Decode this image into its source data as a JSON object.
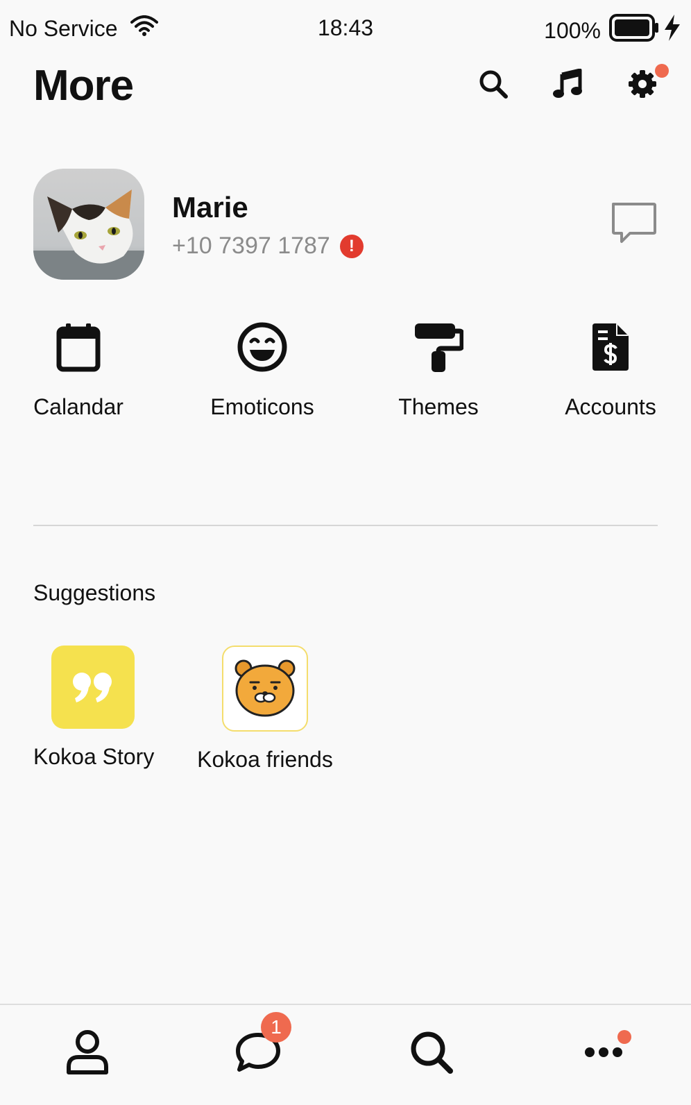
{
  "status_bar": {
    "carrier": "No Service",
    "time": "18:43",
    "battery": "100%"
  },
  "header": {
    "title": "More",
    "icons": [
      "search-icon",
      "music-icon",
      "settings-icon"
    ],
    "settings_has_notification": true
  },
  "profile": {
    "name": "Marie",
    "phone": "+10 7397 1787",
    "alert_mark": "!"
  },
  "quick_menu": [
    {
      "label": "Calandar",
      "icon": "calendar-icon"
    },
    {
      "label": "Emoticons",
      "icon": "emoticon-icon"
    },
    {
      "label": "Themes",
      "icon": "paint-roller-icon"
    },
    {
      "label": "Accounts",
      "icon": "invoice-dollar-icon"
    }
  ],
  "suggestions": {
    "title": "Suggestions",
    "items": [
      {
        "label": "Kokoa Story",
        "icon": "quote-icon"
      },
      {
        "label": "Kokoa friends",
        "icon": "bear-face-icon"
      }
    ]
  },
  "tab_bar": {
    "items": [
      "person-icon",
      "chat-bubble-icon",
      "search-icon",
      "more-dots-icon"
    ],
    "chat_badge": "1"
  },
  "colors": {
    "accent": "#ef6a4f",
    "alert": "#e23b2e",
    "story_yellow": "#f5e14e",
    "bear_orange": "#f2a93b"
  }
}
